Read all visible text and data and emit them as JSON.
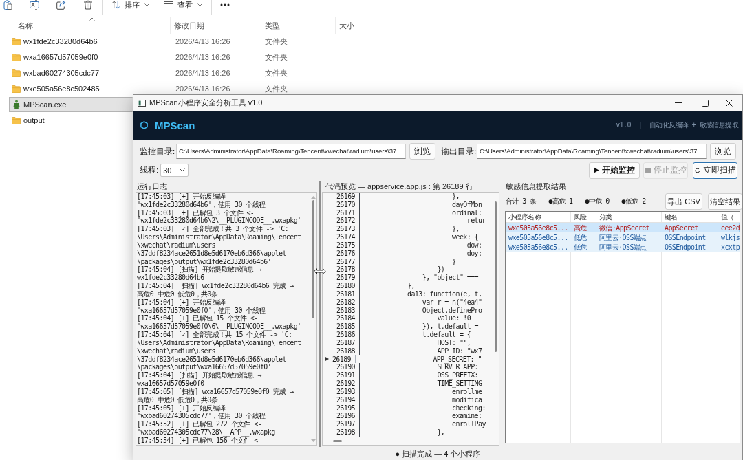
{
  "explorer": {
    "toolbar": {
      "sort_label": "排序",
      "view_label": "查看"
    },
    "columns": [
      {
        "label": "名称",
        "sorted": true
      },
      {
        "label": "修改日期",
        "sorted": false
      },
      {
        "label": "类型",
        "sorted": false
      },
      {
        "label": "大小",
        "sorted": false
      }
    ],
    "rows": [
      {
        "kind": "folder",
        "name": "wx1fde2c33280d64b6",
        "modified": "2026/4/13 16:26",
        "type": "文件夹",
        "selected": false
      },
      {
        "kind": "folder",
        "name": "wxa16657d57059e0f0",
        "modified": "2026/4/13 16:26",
        "type": "文件夹",
        "selected": false
      },
      {
        "kind": "folder",
        "name": "wxbad60274305cdc77",
        "modified": "2026/4/13 16:26",
        "type": "文件夹",
        "selected": false
      },
      {
        "kind": "folder",
        "name": "wxe505a56e8c502485",
        "modified": "2026/4/13 16:26",
        "type": "文件夹",
        "selected": false
      },
      {
        "kind": "exe",
        "name": "MPScan.exe",
        "selected": true
      },
      {
        "kind": "folder",
        "name": "output",
        "selected": false
      }
    ]
  },
  "window": {
    "title": "MPScan小程序安全分析工具 v1.0",
    "header": {
      "app_name": "MPScan",
      "tagline": "v1.0  |  自动化反编译 + 敏感信息提取"
    },
    "monitor_dir": {
      "label": "监控目录:",
      "value": "C:\\Users\\Administrator\\AppData\\Roaming\\Tencent\\xwechat\\radium\\users\\37",
      "button": "浏览"
    },
    "output_dir": {
      "label": "输出目录:",
      "value": "C:\\Users\\Administrator\\AppData\\Roaming\\Tencent\\xwechat\\radium\\users\\37",
      "button": "浏览"
    },
    "threads": {
      "label": "线程:",
      "value": "30"
    },
    "actions": [
      {
        "kind": "start",
        "label": "开始监控",
        "disabled": false,
        "focused": false
      },
      {
        "kind": "stop",
        "label": "停止监控",
        "disabled": true,
        "focused": false
      },
      {
        "kind": "scan",
        "label": "立即扫描",
        "disabled": false,
        "focused": true
      }
    ],
    "log": {
      "title": "运行日志",
      "lines": [
        "[17:45:03] [+] 开始反编译",
        "'wx1fde2c33280d64b6'，使用 30 个线程",
        "[17:45:03] [+] 已解包 3 个文件 <-",
        "'wx1fde2c33280d64b6\\2\\__PLUGINCODE__.wxapkg'",
        "[17:45:03] [✓] 全部完成！共 3 个文件 -> 'C:",
        "\\Users\\Administrator\\AppData\\Roaming\\Tencent",
        "\\xwechat\\radium\\users",
        "\\37ddf8234ace2651d8e5d6170eb6d366\\applet",
        "\\packages\\output\\wx1fde2c33280d64b6'",
        "[17:45:04] [扫描] 开始提取敏感信息 →",
        "wx1fde2c33280d64b6",
        "[17:45:04] [扫描] wx1fde2c33280d64b6 完成 →",
        "高危0 中危0 低危0，共0条",
        "[17:45:04] [+] 开始反编译",
        "'wxa16657d57059e0f0'，使用 30 个线程",
        "[17:45:04] [+] 已解包 15 个文件 <-",
        "'wxa16657d57059e0f0\\6\\__PLUGINCODE__.wxapkg'",
        "[17:45:04] [✓] 全部完成！共 15 个文件 -> 'C:",
        "\\Users\\Administrator\\AppData\\Roaming\\Tencent",
        "\\xwechat\\radium\\users",
        "\\37ddf8234ace2651d8e5d6170eb6d366\\applet",
        "\\packages\\output\\wxa16657d57059e0f0'",
        "[17:45:04] [扫描] 开始提取敏感信息 →",
        "wxa16657d57059e0f0",
        "[17:45:05] [扫描] wxa16657d57059e0f0 完成 →",
        "高危0 中危0 低危0，共0条",
        "[17:45:05] [+] 开始反编译",
        "'wxbad60274305cdc77'，使用 30 个线程",
        "[17:45:52] [+] 已解包 272 个文件 <-",
        "'wxbad60274305cdc77\\28\\__APP__.wxapkg'",
        "[17:45:54] [+] 已解包 156 个文件 <-"
      ]
    },
    "code": {
      "title": "代码预览 — appservice.app.js : 第 26189 行",
      "lines": [
        {
          "number": "26169",
          "text": "                        },",
          "current": false
        },
        {
          "number": "26170",
          "text": "                        dayOfMon",
          "current": false
        },
        {
          "number": "26171",
          "text": "                        ordinal:",
          "current": false
        },
        {
          "number": "26172",
          "text": "                            retur",
          "current": false
        },
        {
          "number": "26173",
          "text": "                        },",
          "current": false
        },
        {
          "number": "26174",
          "text": "                        week: {",
          "current": false
        },
        {
          "number": "26175",
          "text": "                            dow:",
          "current": false
        },
        {
          "number": "26176",
          "text": "                            doy:",
          "current": false
        },
        {
          "number": "26177",
          "text": "                        }",
          "current": false
        },
        {
          "number": "26178",
          "text": "                    })",
          "current": false
        },
        {
          "number": "26179",
          "text": "                }, \"object\" ===",
          "current": false
        },
        {
          "number": "26180",
          "text": "            },",
          "current": false
        },
        {
          "number": "26181",
          "text": "            da13: function(e, t,",
          "current": false
        },
        {
          "number": "26182",
          "text": "                var r = n(\"4ea4\"",
          "current": false
        },
        {
          "number": "26183",
          "text": "                Object.definePro",
          "current": false
        },
        {
          "number": "26184",
          "text": "                    value: !0",
          "current": false
        },
        {
          "number": "26185",
          "text": "                }), t.default =",
          "current": false
        },
        {
          "number": "26186",
          "text": "                t.default = {",
          "current": false
        },
        {
          "number": "26187",
          "text": "                    HOST: \"\",",
          "current": false
        },
        {
          "number": "26188",
          "text": "                    APP_ID: \"wx7",
          "current": false
        },
        {
          "number": "26189",
          "text": "                    APP_SECRET: \"",
          "current": true
        },
        {
          "number": "26190",
          "text": "                    SERVER_APP:",
          "current": false
        },
        {
          "number": "26191",
          "text": "                    OSS_PREFIX:",
          "current": false
        },
        {
          "number": "26192",
          "text": "                    TIME_SETTING",
          "current": false
        },
        {
          "number": "26193",
          "text": "                        enrollme",
          "current": false
        },
        {
          "number": "26194",
          "text": "                        modifica",
          "current": false
        },
        {
          "number": "26195",
          "text": "                        checking:",
          "current": false
        },
        {
          "number": "26196",
          "text": "                        examine:",
          "current": false
        },
        {
          "number": "26197",
          "text": "                        enrollPay",
          "current": false
        },
        {
          "number": "26198",
          "text": "                    },",
          "current": false
        }
      ]
    },
    "results": {
      "title": "敏感信息提取结果",
      "summary": {
        "total": "合计 3 条",
        "counts": [
          "●高危 1",
          "●中危 0",
          "●低危 2"
        ]
      },
      "buttons": [
        "导出 CSV",
        "清空结果"
      ],
      "columns": [
        "小程序名称",
        "风险",
        "分类",
        "键名",
        "值（"
      ],
      "rows": [
        {
          "kind": "high",
          "selected": true,
          "cells": [
            "wxe505a56e8c5...",
            "高危",
            "微信·AppSecret",
            "AppSecret",
            "eee2d"
          ]
        },
        {
          "kind": "low",
          "selected": false,
          "cells": [
            "wxe505a56e8c5...",
            "低危",
            "阿里云·OSS端点",
            "OSSEndpoint",
            "wlkjs"
          ]
        },
        {
          "kind": "low",
          "selected": false,
          "cells": [
            "wxe505a56e8c5...",
            "低危",
            "阿里云·OSS端点",
            "OSSEndpoint",
            "xcxtp"
          ]
        }
      ]
    },
    "status": "● 扫描完成 — 4 个小程序"
  }
}
